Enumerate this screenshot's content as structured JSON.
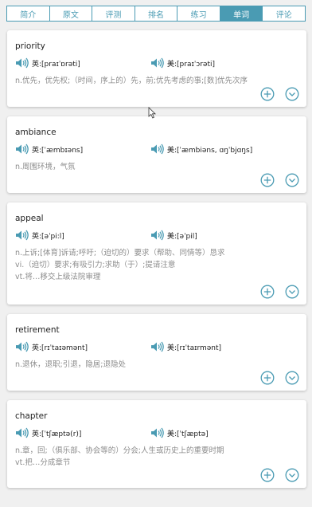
{
  "tabs": [
    {
      "label": "简介",
      "active": false
    },
    {
      "label": "原文",
      "active": false
    },
    {
      "label": "评测",
      "active": false
    },
    {
      "label": "排名",
      "active": false
    },
    {
      "label": "练习",
      "active": false
    },
    {
      "label": "单词",
      "active": true
    },
    {
      "label": "评论",
      "active": false
    }
  ],
  "colors": {
    "accent": "#4a9bb3",
    "definition": "#8c8c8c"
  },
  "words": [
    {
      "word": "priority",
      "uk": "英:[praɪˈɒrəti]",
      "us": "美:[praɪˈɔrəti]",
      "definitions": [
        "n.优先，优先权;（时间，序上的）先，前;优先考虑的事;[数]优先次序"
      ]
    },
    {
      "word": "ambiance",
      "uk": "英:[ˈæmbɪəns]",
      "us": "美:[ˈæmbiəns, ɑŋˈbjɑŋs]",
      "definitions": [
        "n.周围环境，气氛"
      ]
    },
    {
      "word": "appeal",
      "uk": "英:[əˈpi:l]",
      "us": "美:[əˈpil]",
      "definitions": [
        "n.上诉;[体育]诉请;呼吁;（迫切的）要求（帮助、同情等）恳求",
        "vi.（迫切）要求;有吸引力;求助（于）;提请注意",
        "vt.将…移交上级法院审理"
      ]
    },
    {
      "word": "retirement",
      "uk": "英:[rɪˈtaɪəmənt]",
      "us": "美:[rɪˈtaɪrmənt]",
      "definitions": [
        "n.退休，退职;引退，隐居;退隐处"
      ]
    },
    {
      "word": "chapter",
      "uk": "英:[ˈtʃæptə(r)]",
      "us": "美:[ˈtʃæptə]",
      "definitions": [
        "n.章，回;（俱乐部、协会等的）分会;人生或历史上的重要时期",
        "vt.把…分成章节"
      ]
    }
  ],
  "icons": {
    "speaker": "speaker-icon",
    "add": "add-circle-icon",
    "expand": "chevron-down-circle-icon",
    "cursor": "mouse-cursor-icon"
  }
}
